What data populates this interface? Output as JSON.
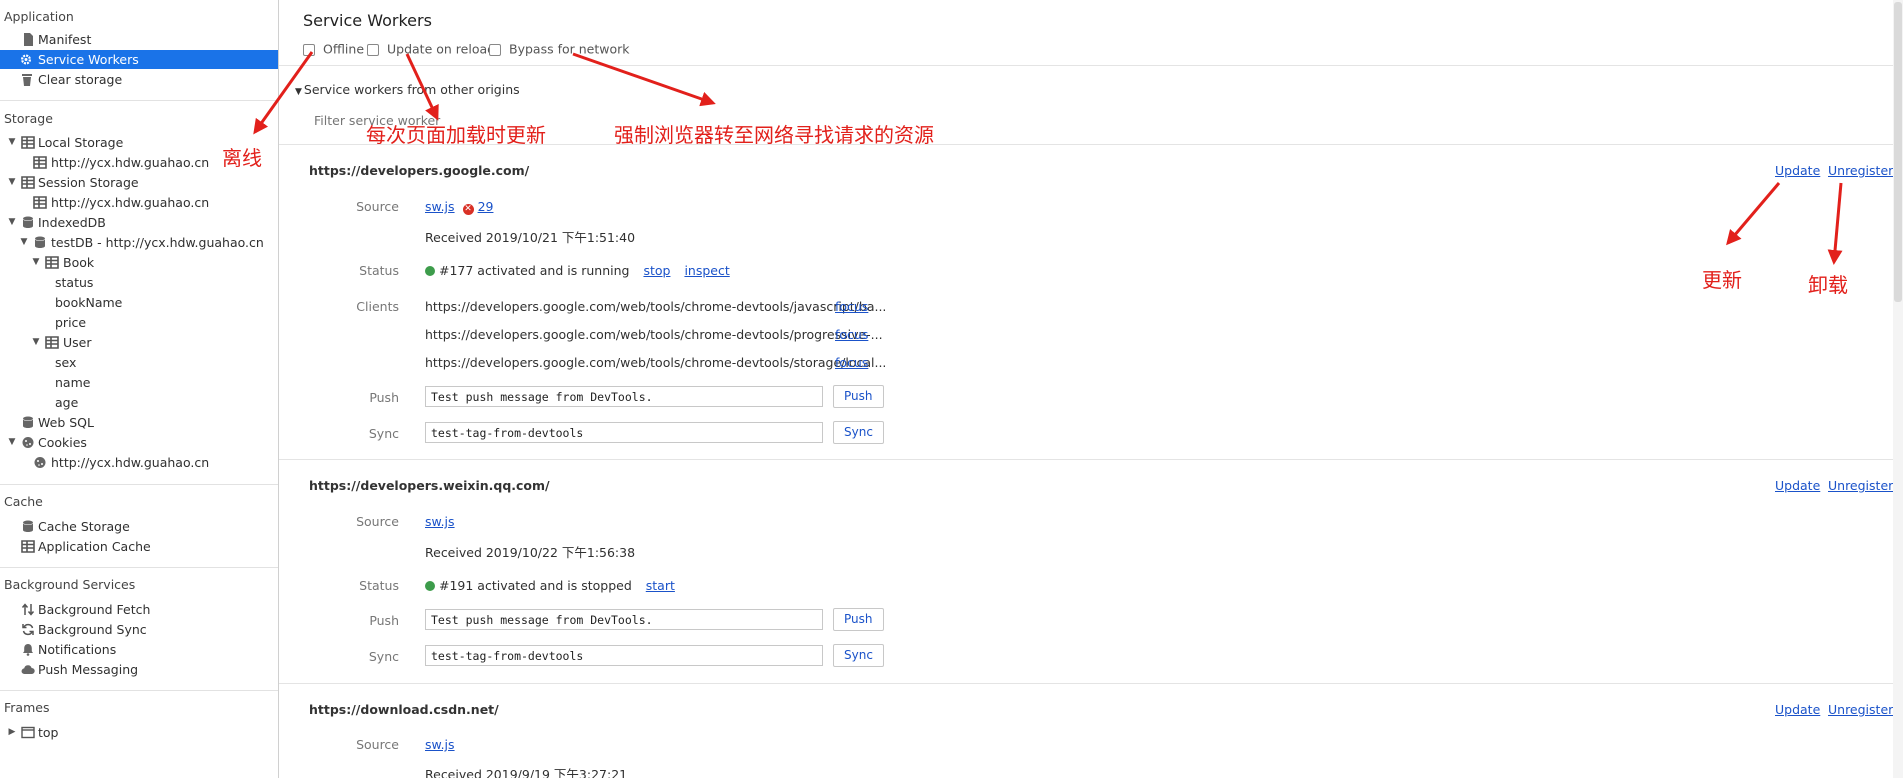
{
  "sidebar": {
    "application": {
      "title": "Application",
      "items": [
        "Manifest",
        "Service Workers",
        "Clear storage"
      ]
    },
    "storage": {
      "title": "Storage",
      "local_storage": "Local Storage",
      "local_storage_origin": "http://ycx.hdw.guahao.cn",
      "session_storage": "Session Storage",
      "session_storage_origin": "http://ycx.hdw.guahao.cn",
      "indexeddb": "IndexedDB",
      "testdb": "testDB - http://ycx.hdw.guahao.cn",
      "book": "Book",
      "book_fields": [
        "status",
        "bookName",
        "price"
      ],
      "user": "User",
      "user_fields": [
        "sex",
        "name",
        "age"
      ],
      "web_sql": "Web SQL",
      "cookies": "Cookies",
      "cookies_origin": "http://ycx.hdw.guahao.cn"
    },
    "cache": {
      "title": "Cache",
      "items": [
        "Cache Storage",
        "Application Cache"
      ]
    },
    "background_services": {
      "title": "Background Services",
      "items": [
        "Background Fetch",
        "Background Sync",
        "Notifications",
        "Push Messaging"
      ]
    },
    "frames": {
      "title": "Frames",
      "top": "top"
    }
  },
  "main": {
    "title": "Service Workers",
    "options": {
      "offline": "Offline",
      "update_on_reload": "Update on reload",
      "bypass_for_network": "Bypass for network"
    },
    "other_origins": "Service workers from other origins",
    "filter_placeholder": "Filter service worker",
    "row_labels": {
      "source": "Source",
      "status": "Status",
      "clients": "Clients",
      "push": "Push",
      "sync": "Sync"
    },
    "links": {
      "update": "Update",
      "unregister": "Unregister",
      "push_btn": "Push",
      "sync_btn": "Sync"
    },
    "workers": [
      {
        "origin": "https://developers.google.com/",
        "source_file": "sw.js",
        "error_count": "29",
        "received": "Received 2019/10/21 下午1:51:40",
        "status_text": "#177 activated and is running",
        "status_action_1": "stop",
        "status_action_2": "inspect",
        "clients": [
          "https://developers.google.com/web/tools/chrome-devtools/javascript/ba...",
          "https://developers.google.com/web/tools/chrome-devtools/progressive-...",
          "https://developers.google.com/web/tools/chrome-devtools/storage/local..."
        ],
        "client_action": "focus",
        "push_value": "Test push message from DevTools.",
        "sync_value": "test-tag-from-devtools"
      },
      {
        "origin": "https://developers.weixin.qq.com/",
        "source_file": "sw.js",
        "received": "Received 2019/10/22 下午1:56:38",
        "status_text": "#191 activated and is stopped",
        "status_action_1": "start",
        "push_value": "Test push message from DevTools.",
        "sync_value": "test-tag-from-devtools"
      },
      {
        "origin": "https://download.csdn.net/",
        "source_file": "sw.js",
        "received": "Received 2019/9/19 下午3:27:21"
      }
    ]
  },
  "annotations": {
    "offline": "离线",
    "update_on_reload": "每次页面加载时更新",
    "bypass": "强制浏览器转至网络寻找请求的资源",
    "update": "更新",
    "unregister": "卸载"
  },
  "colors": {
    "selected": "#1a73e8",
    "link": "#1a52c9",
    "annotation": "#e2201b",
    "status_ok": "#3d9c4b",
    "error": "#d93025"
  }
}
